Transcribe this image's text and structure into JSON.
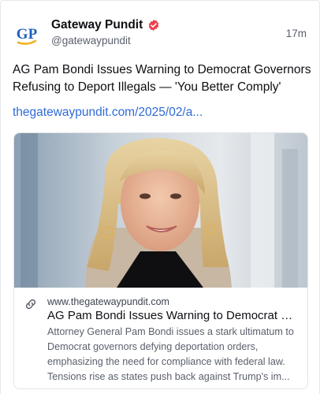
{
  "post": {
    "author": {
      "avatar_text": "GP",
      "display_name": "Gateway Pundit",
      "handle": "@gatewaypundit",
      "verified_icon": "verified-badge-icon"
    },
    "timestamp": "17m",
    "text": "AG Pam Bondi Issues Warning to Democrat Governors Refusing to Deport Illegals — 'You Better Comply'",
    "link_text": "thegatewaypundit.com/2025/02/a...",
    "link_color": "#2e6bd6"
  },
  "card": {
    "image_icon": "news-photo",
    "link_icon": "link-icon",
    "domain": "www.thegatewaypundit.com",
    "title": "AG Pam Bondi Issues Warning to Democrat Go...",
    "description": "Attorney General Pam Bondi issues a stark ultimatum to Democrat governors defying deportation orders, emphasizing the need for compliance with federal law. Tensions rise as states push back against Trump's im..."
  },
  "colors": {
    "brand_blue": "#1f5fbf",
    "brand_gold": "#f0b323",
    "verified": "#e8434f"
  }
}
